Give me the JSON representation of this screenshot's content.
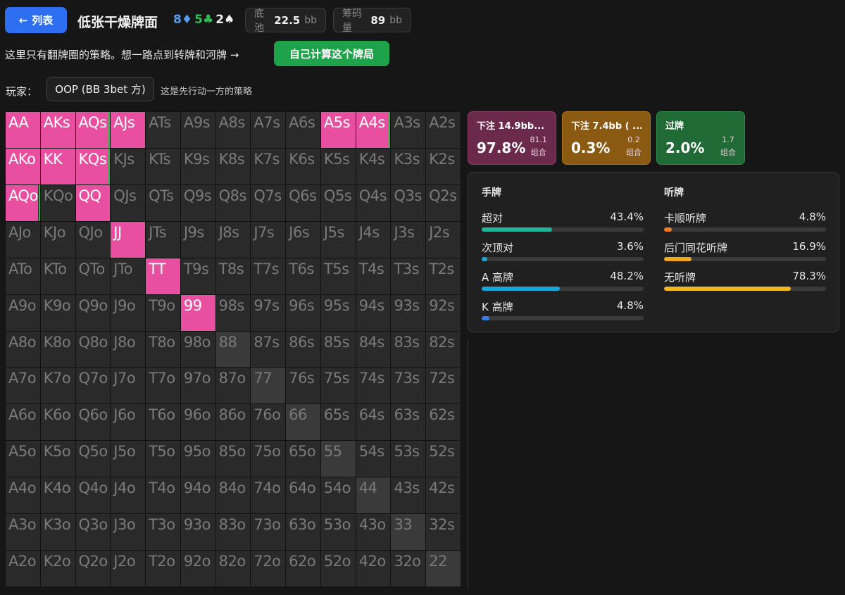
{
  "header": {
    "back_label": "列表",
    "title": "低张干燥牌面",
    "board": [
      {
        "rank": "8",
        "suit": "♦",
        "color": "#5a9cf0"
      },
      {
        "rank": "5",
        "suit": "♣",
        "color": "#2fbf55"
      },
      {
        "rank": "2",
        "suit": "♠",
        "color": "#f0f0f0"
      }
    ],
    "pot_label": "底池",
    "pot_value": "22.5",
    "pot_unit": "bb",
    "stack_label": "筹码量",
    "stack_value": "89",
    "stack_unit": "bb"
  },
  "note": "这里只有翻牌圈的策略。想一路点到转牌和河牌 →",
  "calc_button": "自己计算这个牌局",
  "player": {
    "label": "玩家：",
    "selected": "OOP (BB 3bet 方)",
    "description": "这是先行动一方的策略"
  },
  "colors": {
    "bet_large": "#e84fa0",
    "bet_small": "#d99a2a",
    "check": "#35b24a"
  },
  "grid": {
    "cells": [
      [
        "AA",
        "AKs",
        "AQs",
        "AJs",
        "ATs",
        "A9s",
        "A8s",
        "A7s",
        "A6s",
        "A5s",
        "A4s",
        "A3s",
        "A2s"
      ],
      [
        "AKo",
        "KK",
        "KQs",
        "KJs",
        "KTs",
        "K9s",
        "K8s",
        "K7s",
        "K6s",
        "K5s",
        "K4s",
        "K3s",
        "K2s"
      ],
      [
        "AQo",
        "KQo",
        "QQ",
        "QJs",
        "QTs",
        "Q9s",
        "Q8s",
        "Q7s",
        "Q6s",
        "Q5s",
        "Q4s",
        "Q3s",
        "Q2s"
      ],
      [
        "AJo",
        "KJo",
        "QJo",
        "JJ",
        "JTs",
        "J9s",
        "J8s",
        "J7s",
        "J6s",
        "J5s",
        "J4s",
        "J3s",
        "J2s"
      ],
      [
        "ATo",
        "KTo",
        "QTo",
        "JTo",
        "TT",
        "T9s",
        "T8s",
        "T7s",
        "T6s",
        "T5s",
        "T4s",
        "T3s",
        "T2s"
      ],
      [
        "A9o",
        "K9o",
        "Q9o",
        "J9o",
        "T9o",
        "99",
        "98s",
        "97s",
        "96s",
        "95s",
        "94s",
        "93s",
        "92s"
      ],
      [
        "A8o",
        "K8o",
        "Q8o",
        "J8o",
        "T8o",
        "98o",
        "88",
        "87s",
        "86s",
        "85s",
        "84s",
        "83s",
        "82s"
      ],
      [
        "A7o",
        "K7o",
        "Q7o",
        "J7o",
        "T7o",
        "97o",
        "87o",
        "77",
        "76s",
        "75s",
        "74s",
        "73s",
        "72s"
      ],
      [
        "A6o",
        "K6o",
        "Q6o",
        "J6o",
        "T6o",
        "96o",
        "86o",
        "76o",
        "66",
        "65s",
        "64s",
        "63s",
        "62s"
      ],
      [
        "A5o",
        "K5o",
        "Q5o",
        "J5o",
        "T5o",
        "95o",
        "85o",
        "75o",
        "65o",
        "55",
        "54s",
        "53s",
        "52s"
      ],
      [
        "A4o",
        "K4o",
        "Q4o",
        "J4o",
        "T4o",
        "94o",
        "84o",
        "74o",
        "64o",
        "54o",
        "44",
        "43s",
        "42s"
      ],
      [
        "A3o",
        "K3o",
        "Q3o",
        "J3o",
        "T3o",
        "93o",
        "83o",
        "73o",
        "63o",
        "53o",
        "43o",
        "33",
        "32s"
      ],
      [
        "A2o",
        "K2o",
        "Q2o",
        "J2o",
        "T2o",
        "92o",
        "82o",
        "72o",
        "62o",
        "52o",
        "42o",
        "32o",
        "22"
      ]
    ],
    "strategy": {
      "AA": 1,
      "AKs": 1,
      "AQs": 0.97,
      "AJs": 1,
      "A5s": 1,
      "A4s": 0.98,
      "AKo": 1,
      "KK": 1,
      "KQs": 0.97,
      "AQo": 0.95,
      "QQ": 1,
      "JJ": 1,
      "TT": 1,
      "99": 1
    },
    "check_edge": [
      "AQs",
      "A4s",
      "AQo",
      "KQs"
    ]
  },
  "actions": [
    {
      "name": "下注 14.9bb...",
      "pct": "97.8%",
      "combos": "81.1",
      "combo_label": "组合"
    },
    {
      "name": "下注 7.4bb ( ...",
      "pct": "0.3%",
      "combos": "0.2",
      "combo_label": "组合"
    },
    {
      "name": "过牌",
      "pct": "2.0%",
      "combos": "1.7",
      "combo_label": "组合"
    }
  ],
  "stats": {
    "hands_title": "手牌",
    "hands": [
      {
        "label": "超对",
        "value": "43.4%",
        "fraction": 0.434,
        "color": "#1fb39a"
      },
      {
        "label": "次顶对",
        "value": "3.6%",
        "fraction": 0.036,
        "color": "#1ba6d8"
      },
      {
        "label": "A 高牌",
        "value": "48.2%",
        "fraction": 0.482,
        "color": "#1ba6d8"
      },
      {
        "label": "K 高牌",
        "value": "4.8%",
        "fraction": 0.048,
        "color": "#3b7be8"
      }
    ],
    "draws_title": "听牌",
    "draws": [
      {
        "label": "卡顺听牌",
        "value": "4.8%",
        "fraction": 0.048,
        "color": "#f07a1f"
      },
      {
        "label": "后门同花听牌",
        "value": "16.9%",
        "fraction": 0.169,
        "color": "#f0a81f"
      },
      {
        "label": "无听牌",
        "value": "78.3%",
        "fraction": 0.783,
        "color": "#f0b81f"
      }
    ]
  }
}
